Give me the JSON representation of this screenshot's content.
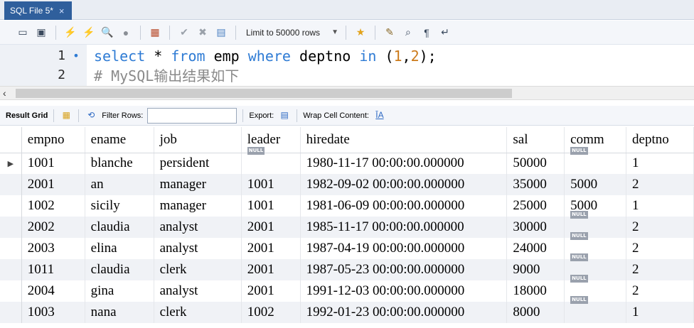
{
  "tab": {
    "title": "SQL File 5*",
    "close": "×"
  },
  "toolbar": {
    "icons": [
      "folder-icon",
      "save-icon",
      "execute-icon",
      "execute-current-icon",
      "explain-icon",
      "stop-icon",
      "toggle-icon",
      "commit-icon",
      "rollback-icon",
      "autocommit-icon"
    ],
    "limit_label": "Limit to 50000 rows",
    "right_icons": [
      "beautify-icon",
      "find-icon",
      "invisible-icon",
      "wrap-icon"
    ]
  },
  "editor": {
    "lines": [
      {
        "num": "1",
        "marker": "•"
      },
      {
        "num": "2",
        "marker": ""
      }
    ],
    "line1": {
      "kw_select": "select",
      "star": " * ",
      "kw_from": "from",
      "table": " emp ",
      "kw_where": "where",
      "col": " deptno ",
      "kw_in": "in",
      "open": " (",
      "n1": "1",
      "comma": ",",
      "n2": "2",
      "close": ");"
    },
    "line2": "# MySQL输出结果如下"
  },
  "scroll": {
    "left_arrow": "‹"
  },
  "result_toolbar": {
    "result_grid": "Result Grid",
    "filter_rows": "Filter Rows:",
    "filter_value": "",
    "export": "Export:",
    "wrap": "Wrap Cell Content:",
    "wrap_icon": "ĪA"
  },
  "grid": {
    "columns": [
      "empno",
      "ename",
      "job",
      "leader",
      "hiredate",
      "sal",
      "comm",
      "deptno"
    ],
    "null_label": "NULL",
    "current_marker": "▶",
    "rows": [
      [
        "1001",
        "blanche",
        "persident",
        null,
        "1980-11-17 00:00:00.000000",
        "50000",
        null,
        "1"
      ],
      [
        "2001",
        "an",
        "manager",
        "1001",
        "1982-09-02 00:00:00.000000",
        "35000",
        "5000",
        "2"
      ],
      [
        "1002",
        "sicily",
        "manager",
        "1001",
        "1981-06-09 00:00:00.000000",
        "25000",
        "5000",
        "1"
      ],
      [
        "2002",
        "claudia",
        "analyst",
        "2001",
        "1985-11-17 00:00:00.000000",
        "30000",
        null,
        "2"
      ],
      [
        "2003",
        "elina",
        "analyst",
        "2001",
        "1987-04-19 00:00:00.000000",
        "24000",
        null,
        "2"
      ],
      [
        "1011",
        "claudia",
        "clerk",
        "2001",
        "1987-05-23 00:00:00.000000",
        "9000",
        null,
        "2"
      ],
      [
        "2004",
        "gina",
        "analyst",
        "2001",
        "1991-12-03 00:00:00.000000",
        "18000",
        null,
        "2"
      ],
      [
        "1003",
        "nana",
        "clerk",
        "1002",
        "1992-01-23 00:00:00.000000",
        "8000",
        null,
        "1"
      ]
    ]
  }
}
